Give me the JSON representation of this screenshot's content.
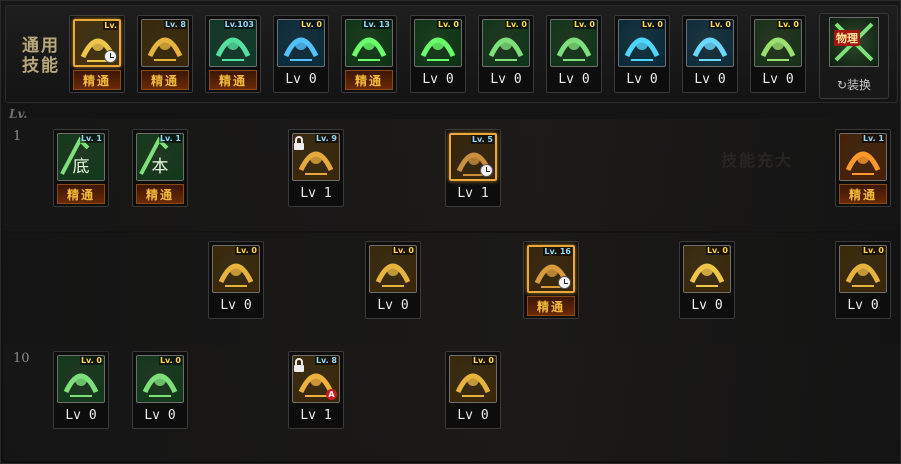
{
  "common": {
    "label": "通用\n技能",
    "skills": [
      {
        "name": "common-skill-1",
        "lv": "Lv.",
        "status": "精通",
        "mastered": true,
        "selected": true,
        "clock": true,
        "lvColor": "#ffd34a",
        "bg": "#4a3208",
        "fg": "#f0c64a"
      },
      {
        "name": "common-skill-2",
        "lv": "Lv. 8",
        "status": "精通",
        "mastered": true,
        "lvColor": "#8fd7ff",
        "bg": "#3a2606",
        "fg": "#e6b33c"
      },
      {
        "name": "common-skill-3",
        "lv": "Lv.103",
        "status": "精通",
        "mastered": true,
        "lvColor": "#8fd7ff",
        "bg": "#0d3a28",
        "fg": "#53e0a0"
      },
      {
        "name": "common-skill-4",
        "lv": "Lv. 0",
        "status": "Lv 0",
        "mastered": false,
        "lvColor": "#ffd34a",
        "bg": "#062a3a",
        "fg": "#53c2ff"
      },
      {
        "name": "common-skill-5",
        "lv": "Lv. 13",
        "status": "精通",
        "mastered": true,
        "lvColor": "#8fd7ff",
        "bg": "#0a3214",
        "fg": "#6aff6a"
      },
      {
        "name": "common-skill-6",
        "lv": "Lv. 0",
        "status": "Lv 0",
        "mastered": false,
        "lvColor": "#ffd34a",
        "bg": "#0a3214",
        "fg": "#6aff6a"
      },
      {
        "name": "common-skill-7",
        "lv": "Lv. 0",
        "status": "Lv 0",
        "mastered": false,
        "lvColor": "#ffd34a",
        "bg": "#0c3418",
        "fg": "#7de07a"
      },
      {
        "name": "common-skill-8",
        "lv": "Lv. 0",
        "status": "Lv 0",
        "mastered": false,
        "lvColor": "#ffd34a",
        "bg": "#0c3418",
        "fg": "#7de07a"
      },
      {
        "name": "common-skill-9",
        "lv": "Lv. 0",
        "status": "Lv 0",
        "mastered": false,
        "lvColor": "#ffd34a",
        "bg": "#06283a",
        "fg": "#4fd6ff"
      },
      {
        "name": "common-skill-10",
        "lv": "Lv. 0",
        "status": "Lv 0",
        "mastered": false,
        "lvColor": "#ffd34a",
        "bg": "#0a2a3a",
        "fg": "#6ad8ff"
      },
      {
        "name": "common-skill-11",
        "lv": "Lv. 0",
        "status": "Lv 0",
        "mastered": false,
        "lvColor": "#ffd34a",
        "bg": "#153018",
        "fg": "#9ae070"
      }
    ],
    "swap": {
      "badge": "物理",
      "label": "↻装换"
    }
  },
  "lv_header": "Lv.",
  "watermark": "技能充大",
  "rows": [
    {
      "num": "1",
      "skills": [
        {
          "name": "row1-skill-1",
          "lv": "Lv. 1",
          "status": "精通",
          "mastered": true,
          "glyph": "底",
          "lvColor": "#8fd7ff",
          "bg": "#0e3a1a",
          "fg": "#7de07a"
        },
        {
          "name": "row1-skill-2",
          "lv": "Lv. 1",
          "status": "精通",
          "mastered": true,
          "glyph": "本",
          "lvColor": "#8fd7ff",
          "bg": "#0e3a1a",
          "fg": "#7de07a"
        },
        {
          "name": "row1-skill-3",
          "lv": "Lv. 9",
          "status": "Lv 1",
          "mastered": false,
          "lock": true,
          "lvColor": "#8fd7ff",
          "bg": "#3a2606",
          "fg": "#e6a93c"
        },
        {
          "name": "row1-skill-4",
          "lv": "Lv. 5",
          "status": "Lv 1",
          "mastered": false,
          "clock": true,
          "selected": true,
          "lvColor": "#8fd7ff",
          "bg": "#3a2606",
          "fg": "#c98f3c"
        },
        {
          "name": "row1-skill-5",
          "lv": "Lv. 1",
          "status": "精通",
          "mastered": true,
          "lvColor": "#8fd7ff",
          "bg": "#4a1e06",
          "fg": "#ff9a2a"
        }
      ]
    },
    {
      "num": "",
      "skills": [
        {
          "name": "row2-skill-1",
          "lv": "Lv. 0",
          "status": "Lv 0",
          "mastered": false,
          "lvColor": "#ffd34a",
          "bg": "#3a2606",
          "fg": "#e6b33c"
        },
        {
          "name": "row2-skill-2",
          "lv": "Lv. 0",
          "status": "Lv 0",
          "mastered": false,
          "lvColor": "#ffd34a",
          "bg": "#3a2606",
          "fg": "#e6b33c"
        },
        {
          "name": "row2-skill-3",
          "lv": "Lv. 16",
          "status": "精通",
          "mastered": true,
          "clock": true,
          "selected": true,
          "lvColor": "#8fd7ff",
          "bg": "#3a2606",
          "fg": "#d89b3c"
        },
        {
          "name": "row2-skill-4",
          "lv": "Lv. 0",
          "status": "Lv 0",
          "mastered": false,
          "lvColor": "#ffd34a",
          "bg": "#3a2606",
          "fg": "#f0c64a"
        },
        {
          "name": "row2-skill-5",
          "lv": "Lv. 0",
          "status": "Lv 0",
          "mastered": false,
          "lvColor": "#ffd34a",
          "bg": "#3a2606",
          "fg": "#e6b33c"
        }
      ]
    },
    {
      "num": "10",
      "skills": [
        {
          "name": "row3-skill-1",
          "lv": "Lv. 0",
          "status": "Lv 0",
          "mastered": false,
          "lvColor": "#ffd34a",
          "bg": "#0e3a1a",
          "fg": "#7de07a"
        },
        {
          "name": "row3-skill-2",
          "lv": "Lv. 0",
          "status": "Lv 0",
          "mastered": false,
          "lvColor": "#ffd34a",
          "bg": "#0e3a1a",
          "fg": "#7de07a"
        },
        {
          "name": "row3-skill-3",
          "lv": "Lv. 8",
          "status": "Lv 1",
          "mastered": false,
          "lock": true,
          "abadge": "A",
          "lvColor": "#8fd7ff",
          "bg": "#3a2606",
          "fg": "#f0b23c"
        },
        {
          "name": "row3-skill-4",
          "lv": "Lv. 0",
          "status": "Lv 0",
          "mastered": false,
          "lvColor": "#ffd34a",
          "bg": "#3a2606",
          "fg": "#e6b33c"
        }
      ]
    }
  ]
}
